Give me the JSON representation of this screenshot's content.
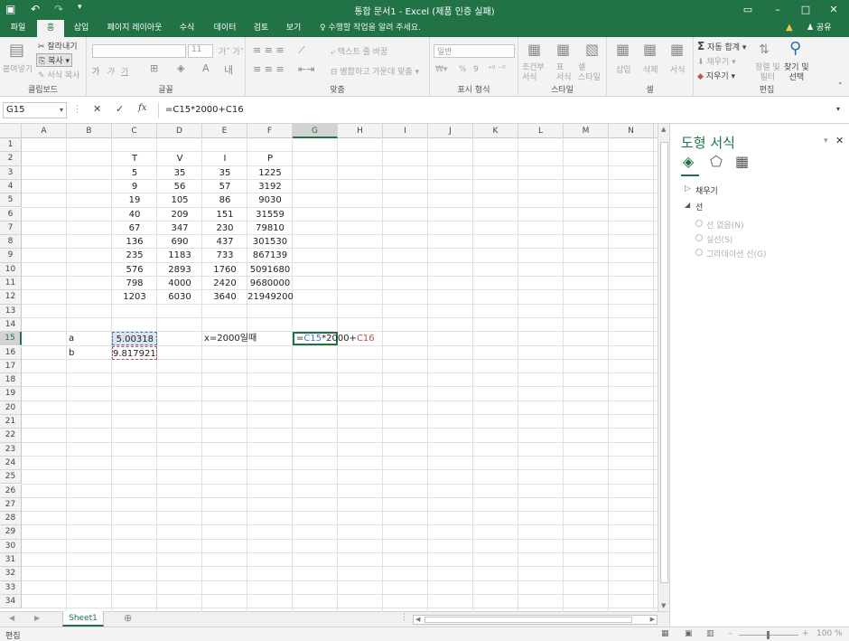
{
  "titlebar": {
    "title": "통합 문서1 - Excel (제품 인증 실패)",
    "save_icon": "floppy-icon",
    "undo": "↶",
    "redo": "↷",
    "ribbon_display": "▭",
    "minimize": "–",
    "maximize": "□",
    "close": "✕"
  },
  "tabs": [
    "파일",
    "홈",
    "삽입",
    "페이지 레이아웃",
    "수식",
    "데이터",
    "검토",
    "보기"
  ],
  "tellme": "♀ 수행할 작업을 알려 주세요.",
  "share": "♟ 공유",
  "warn": "▲",
  "ribbon": {
    "clipboard": {
      "paste": "붙여넣기",
      "cut": "잘라내기",
      "copy": "복사",
      "format_painter": "서식 복사",
      "label": "클립보드"
    },
    "font": {
      "name": "",
      "size": "11",
      "bold": "가",
      "italic": "가",
      "underline": "가",
      "grow": "가",
      "shrink": "가",
      "label": "글꼴"
    },
    "align": {
      "wrap": "텍스트 줄 바꿈",
      "merge": "병합하고 가운데 맞춤",
      "label": "맞춤"
    },
    "number": {
      "format": "일반",
      "percent": "%",
      "comma": "9",
      "label": "표시 형식"
    },
    "styles": {
      "cond": "조건부\n서식",
      "table": "표\n서식",
      "cell": "셀\n스타일",
      "label": "스타일"
    },
    "cells": {
      "insert": "삽입",
      "delete": "삭제",
      "format": "서식",
      "label": "셀"
    },
    "editing": {
      "autosum": "자동 합계",
      "fill": "채우기",
      "clear": "지우기",
      "sort": "정렬 및\n필터",
      "find": "찾기 및\n선택",
      "label": "편집"
    }
  },
  "formula_bar": {
    "name_box": "G15",
    "cancel": "✕",
    "enter": "✓",
    "fx": "fx",
    "formula": "=C15*2000+C16"
  },
  "columns": [
    "A",
    "B",
    "C",
    "D",
    "E",
    "F",
    "G",
    "H",
    "I",
    "J",
    "K",
    "L",
    "M",
    "N"
  ],
  "selected_col": "G",
  "selected_row": 15,
  "rows": 34,
  "table": {
    "headers": [
      "T",
      "V",
      "I",
      "P"
    ],
    "rows": [
      [
        "5",
        "35",
        "35",
        "1225"
      ],
      [
        "9",
        "56",
        "57",
        "3192"
      ],
      [
        "19",
        "105",
        "86",
        "9030"
      ],
      [
        "40",
        "209",
        "151",
        "31559"
      ],
      [
        "67",
        "347",
        "230",
        "79810"
      ],
      [
        "136",
        "690",
        "437",
        "301530"
      ],
      [
        "235",
        "1183",
        "733",
        "867139"
      ],
      [
        "576",
        "2893",
        "1760",
        "5091680"
      ],
      [
        "798",
        "4000",
        "2420",
        "9680000"
      ],
      [
        "1203",
        "6030",
        "3640",
        "21949200"
      ]
    ]
  },
  "cells": {
    "a15": "a",
    "c15": "5.00318",
    "e15": "x=2000일때",
    "a16": "b",
    "c16": "9.817921",
    "g15_eq": "=",
    "g15_ref1": "C15",
    "g15_mid": "*2000+",
    "g15_ref2": "C16"
  },
  "colors": {
    "accent": "#217346",
    "ref1": "#4472c4",
    "ref2": "#c0504d"
  },
  "pane": {
    "title": "도형 서식",
    "fill": "채우기",
    "line": "선",
    "opt1": "선 없음(N)",
    "opt2": "실선(S)",
    "opt3": "그라데이션 선(G)"
  },
  "sheet_tab": "Sheet1",
  "status": {
    "mode": "편집",
    "zoom": "100 %"
  }
}
